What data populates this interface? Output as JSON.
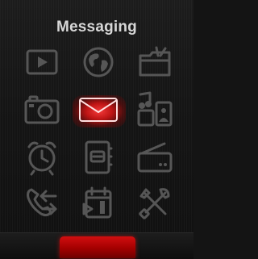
{
  "screen": {
    "title": "Messaging",
    "selected_item": "messaging"
  },
  "icons": [
    {
      "name": "video-player-icon",
      "label": ""
    },
    {
      "name": "browser-globe-icon",
      "label": ""
    },
    {
      "name": "file-manager-icon",
      "label": ""
    },
    {
      "name": "camera-icon",
      "label": ""
    },
    {
      "name": "messaging-icon",
      "label": ""
    },
    {
      "name": "media-gallery-icon",
      "label": ""
    },
    {
      "name": "alarm-clock-icon",
      "label": ""
    },
    {
      "name": "contacts-icon",
      "label": ""
    },
    {
      "name": "fm-radio-icon",
      "label": ""
    },
    {
      "name": "call-log-icon",
      "label": ""
    },
    {
      "name": "calendar-icon",
      "label": ""
    },
    {
      "name": "settings-tools-icon",
      "label": ""
    }
  ],
  "colors": {
    "icon_gray": "#565656",
    "selected_red": "#e01010",
    "title_text": "#d7d7d7",
    "background": "#141414"
  },
  "softkeys": {
    "center_label": ""
  }
}
